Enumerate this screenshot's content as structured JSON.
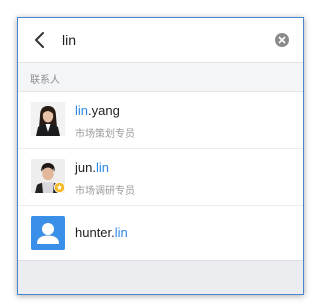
{
  "search": {
    "query": "lin",
    "placeholder": ""
  },
  "section": {
    "title": "联系人"
  },
  "contacts": [
    {
      "name_highlight": "lin",
      "name_rest": ".yang",
      "highlight_first": true,
      "title": "市场策划专员",
      "avatar_icon": "female-photo-avatar"
    },
    {
      "name_rest": "jun.",
      "name_highlight": "lin",
      "highlight_first": false,
      "title": "市场调研专员",
      "avatar_icon": "male-photo-avatar",
      "badge_icon": "star-badge-icon"
    },
    {
      "name_rest": "hunter.",
      "name_highlight": "lin",
      "highlight_first": false,
      "title": "",
      "avatar_icon": "default-person-icon"
    }
  ],
  "colors": {
    "highlight": "#2b87e8",
    "default_avatar_bg": "#3a8fe8",
    "frame_border": "#4a86d0"
  }
}
